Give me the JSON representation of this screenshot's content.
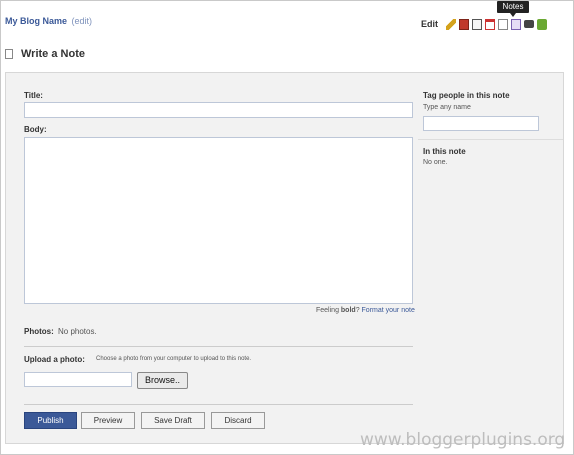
{
  "header": {
    "blog_name": "My Blog Name",
    "edit_link": "(edit)",
    "edit_label": "Edit",
    "tooltip": "Notes",
    "icons": [
      {
        "name": "pencil-icon",
        "color": "#d4a21c"
      },
      {
        "name": "photos-icon",
        "color": "#c0392b"
      },
      {
        "name": "export-icon",
        "color": "#555555"
      },
      {
        "name": "calendar-icon",
        "color": "#cc3333"
      },
      {
        "name": "notes-icon",
        "color": "#888888"
      },
      {
        "name": "wall-icon",
        "color": "#7a5fb0"
      },
      {
        "name": "video-icon",
        "color": "#444444"
      },
      {
        "name": "chat-icon",
        "color": "#6aa832"
      }
    ]
  },
  "page_title": "Write a Note",
  "form": {
    "title_label": "Title:",
    "title_value": "",
    "body_label": "Body:",
    "body_value": "",
    "feeling_prefix": "Feeling ",
    "feeling_bold": "bold",
    "feeling_suffix": "? ",
    "format_link": "Format your note",
    "photos_label": "Photos:",
    "photos_value": "No photos.",
    "upload_label": "Upload a photo:",
    "upload_hint": "Choose a photo from your computer to upload to this note.",
    "browse_label": "Browse..",
    "buttons": {
      "publish": "Publish",
      "preview": "Preview",
      "save_draft": "Save Draft",
      "discard": "Discard"
    }
  },
  "sidebar": {
    "tag_heading": "Tag people in this note",
    "tag_hint": "Type any name",
    "in_note_heading": "In this note",
    "in_note_value": "No one."
  },
  "watermark": "www.bloggerplugins.org"
}
